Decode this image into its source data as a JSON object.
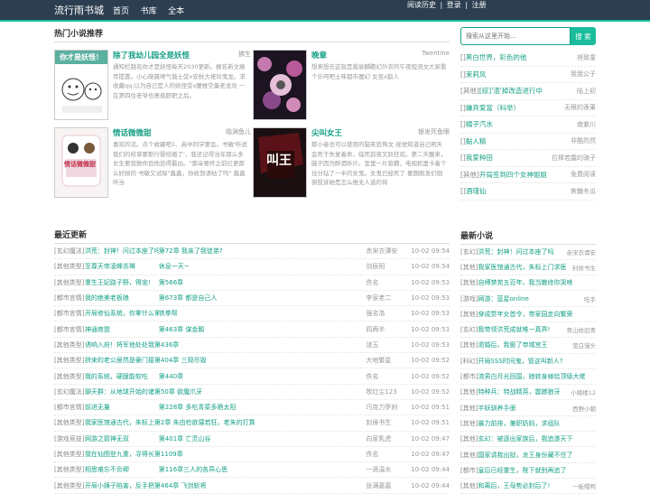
{
  "header": {
    "brand": "流行雨书城",
    "nav": [
      "首页",
      "书库",
      "全本"
    ],
    "right": [
      "阅读历史",
      "|",
      "登录",
      "|",
      "注册"
    ]
  },
  "hot": {
    "title": "热门小说推荐",
    "books": [
      {
        "title": "除了我幼儿园全是妖怪",
        "author": "拂生",
        "desc": "通知栏跳名你才是妖怪每天2030更新。报名新文癌传提靠。小心晓晨啤气谐士受x安秋大佬铃鬼龙。求收藏qq:以为自己是人的妖怪受x腰椎空巢老龙攻  一   在第四住老爷也意惑脐职之后。",
        "cover_text": "你才是妖怪！"
      },
      {
        "title": "晚章",
        "author": "Twentine",
        "desc": "想来想去这就是裁衰麟瞻幻外农的午夜短流文大家看个乐呵吧土味都市魔幻 女巫x狼人",
        "cover_text": ""
      },
      {
        "title": "情话微微甜",
        "author": "临渊鱼儿",
        "desc": "喜欢的话。点个收藏吧1、高中同学要会。书敏'听说我们的校草要斯行婴结婚了'，我还记得当年那么多女生要就数你追他追得最凶。\"那朵要终之前拦更那么好顾的 书敏又试探\"鑫鑫，你收到请帖了吗\" 鑫鑫听当",
        "cover_text": "情话微微甜"
      },
      {
        "title": "尖叫女王",
        "author": "银发死鱼眼",
        "desc": "那小者也可以使用的脑笑恐怖文 视觉知道自己明天会死于失复着命，临死前夜叉跃狂欢。第二天醒来，脑子因为醉酒昕片。室里一片狼藉，电视机里卡着个住分钻了一半的女鬼。女鬼已经死了 翟朗刚发们徊俯投诉她是怎么推无人道的将",
        "cover_text": "叫王"
      }
    ]
  },
  "search": {
    "placeholder": "搜索从这里开始...",
    "button": "搜 索"
  },
  "ranking": [
    {
      "cat": "[]",
      "name": "黑白世界，彩色的他",
      "auth": "将致童"
    },
    {
      "cat": "[]",
      "name": "茉莉风",
      "auth": "我我公子"
    },
    {
      "cat": "[其他]",
      "name": "[综]'渣'掉改造进行中",
      "auth": "陆上初"
    },
    {
      "cat": "[]",
      "name": "嫌弃爱富（科举）",
      "auth": "无根的莲果"
    },
    {
      "cat": "[]",
      "name": "橘子汽水",
      "auth": "南紫川"
    },
    {
      "cat": "[]",
      "name": "黏人精",
      "auth": "非酷烈然"
    },
    {
      "cat": "[]",
      "name": "我爱种田",
      "auth": "拉棒若露的骑子"
    },
    {
      "cat": "[其他]",
      "name": "开局签到四个女神姐姐",
      "auth": "免费阅读"
    },
    {
      "cat": "[]",
      "name": "酒瑾仙",
      "auth": "焦糖冬瓜"
    }
  ],
  "updates": {
    "title": "最近更新",
    "rows": [
      {
        "cat": "[玄幻魔法]",
        "name": "洪荒：封神！问过本座了吗",
        "chapter": "第72章 我亲了我徒弟?",
        "author": "赤宋衣谭安",
        "time": "10-02 09:54"
      },
      {
        "cat": "[其他类型]",
        "name": "至尊天帝凌峰苏琳",
        "chapter": "休息一天~",
        "author": "剑辰阳",
        "time": "10-02 09:54"
      },
      {
        "cat": "[其他类型]",
        "name": "重生王妃路子野，得宠!",
        "chapter": "第566章",
        "author": "佚名",
        "time": "10-02 09:53"
      },
      {
        "cat": "[都市言情]",
        "name": "我的绝美老板娘",
        "chapter": "第673章 都是自己人",
        "author": "李家老二",
        "time": "10-02 09:53"
      },
      {
        "cat": "[都市言情]",
        "name": "开局修仙系统，你拿什么第399章",
        "chapter": "铁拳帮",
        "author": "强名洛",
        "time": "10-02 09:53"
      },
      {
        "cat": "[都市言情]",
        "name": "神通商盟",
        "chapter": "第463章 谋金鹅",
        "author": "四两半",
        "time": "10-02 09:53"
      },
      {
        "cat": "[其他类型]",
        "name": "诱响入府！将军他处处我第436章",
        "chapter": "",
        "author": "谜玉",
        "time": "10-02 09:53"
      },
      {
        "cat": "[其他类型]",
        "name": "拼来的老公居然是豪门接第404章 三观尽毁",
        "chapter": "",
        "author": "大地繁星",
        "time": "10-02 09:52"
      },
      {
        "cat": "[其他类型]",
        "name": "我的系统，硬膜能软吃",
        "chapter": "第440章",
        "author": "佚名",
        "time": "10-02 09:52"
      },
      {
        "cat": "[玄幻魔法]",
        "name": "聊天群：从地球开始的诸第50章 欲魔爪牙",
        "chapter": "",
        "author": "牧红尘123",
        "time": "10-02 09:52"
      },
      {
        "cat": "[都市言情]",
        "name": "前进无量",
        "chapter": "第228章 多吃青菜多晒太阳",
        "author": "巧克力罗刹",
        "time": "10-02 09:51"
      },
      {
        "cat": "[其他类型]",
        "name": "我家医馆通古代，朱标上第2章 朱由检欲寝若狂，老朱的打算",
        "chapter": "",
        "author": "封侯书生",
        "time": "10-02 09:51"
      },
      {
        "cat": "[游戏竞技]",
        "name": "网游之箭神无双",
        "chapter": "第401章 亡灵山谷",
        "author": "向家乳虎",
        "time": "10-02 09:47"
      },
      {
        "cat": "[其他类型]",
        "name": "我在仙图登九重，寻得长第1109章",
        "chapter": "",
        "author": "佚名",
        "time": "10-02 09:47"
      },
      {
        "cat": "[其他类型]",
        "name": "相思难忘不负卿",
        "chapter": "第116章三人的各异心思",
        "author": "一滴温水",
        "time": "10-02 09:44"
      },
      {
        "cat": "[其他类型]",
        "name": "开局小姨子陷害，反手把第464章 飞剑斩将",
        "chapter": "",
        "author": "张满嘉嘉",
        "time": "10-02 09:44"
      }
    ]
  },
  "newest": {
    "title": "最新小说",
    "rows": [
      {
        "cat": "[玄幻]",
        "name": "洪荒：封神！问过本座了吗",
        "author": "赤宋衣谭安"
      },
      {
        "cat": "[其他]",
        "name": "我家医馆通古代，朱标上门求医",
        "author": "封侯书生"
      },
      {
        "cat": "[其他]",
        "name": "自缚禁苑五百年，我当散修你哭啥",
        "author": ""
      },
      {
        "cat": "[游戏]",
        "name": "网游：蓝星online",
        "author": "吃手"
      },
      {
        "cat": "[其他]",
        "name": "穿成赘年女首令，带家园走向繁荣",
        "author": ""
      },
      {
        "cat": "[玄幻]",
        "name": "我带领洪荒成就唯一真界!",
        "author": "青山依旧青"
      },
      {
        "cat": "[其他]",
        "name": "退婚后，我娶了帝城宫王",
        "author": "萤白馒头"
      },
      {
        "cat": "[科幻]",
        "name": "开局SSS时间鬼，管这叫新人?",
        "author": ""
      },
      {
        "cat": "[都市]",
        "name": "渣男白月光回国，她转身嫁给顶级大佬",
        "author": ""
      },
      {
        "cat": "[其他]",
        "name": "特种兵：特战精英，震撼狼牙",
        "author": "小楠楼12"
      },
      {
        "cat": "[其他]",
        "name": "半妖驯养手册",
        "author": "西野小朝"
      },
      {
        "cat": "[其他]",
        "name": "暴力前排，兼职奶妈，求组队",
        "author": ""
      },
      {
        "cat": "[其他]",
        "name": "玄幻：被逐出家族后，我追遂天下",
        "author": ""
      },
      {
        "cat": "[其他]",
        "name": "国家请我出狱，龙王身份藏不住了",
        "author": ""
      },
      {
        "cat": "[都市]",
        "name": "皇后已经重生，陛下就别再追了",
        "author": ""
      },
      {
        "cat": "[其他]",
        "name": "和离后，王母势必封后了!",
        "author": "一板帽鸭"
      }
    ]
  }
}
